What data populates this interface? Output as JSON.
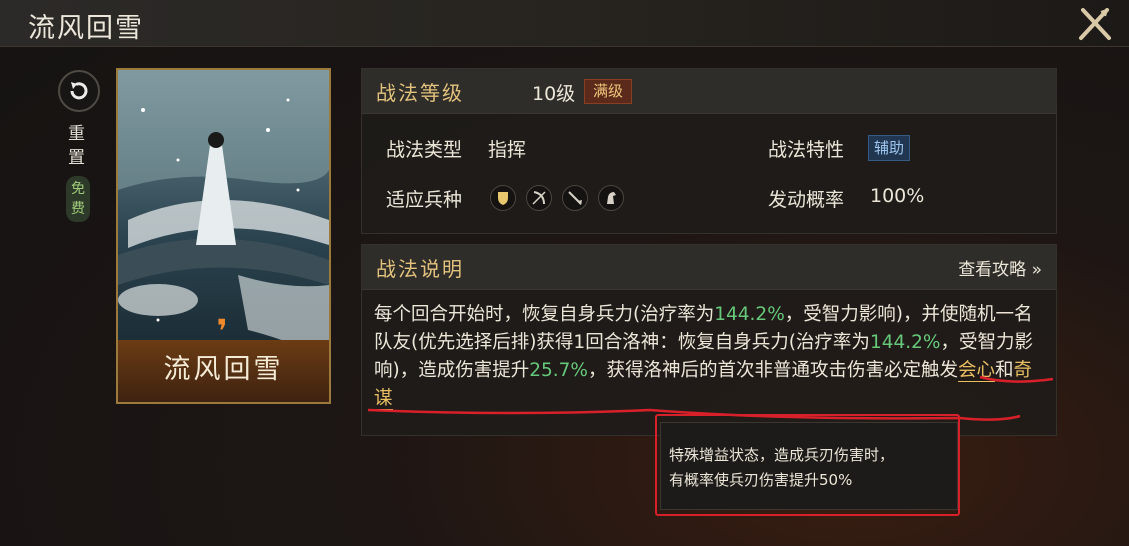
{
  "header": {
    "title": "流风回雪"
  },
  "reset": {
    "label": "重置",
    "free_label": "免费"
  },
  "card": {
    "name": "流风回雪",
    "type_icon": "comma-type-icon"
  },
  "level_panel": {
    "title": "战法等级",
    "level": "10级",
    "max_badge": "满级",
    "type_label": "战法类型",
    "type_value": "指挥",
    "trait_label": "战法特性",
    "trait_value": "辅助",
    "troop_label": "适应兵种",
    "troop_icons": [
      "shield-icon",
      "bow-icon",
      "spear-icon",
      "horse-icon"
    ],
    "chance_label": "发动概率",
    "chance_value": "100%"
  },
  "desc_panel": {
    "title": "战法说明",
    "guide_link": "查看攻略 »",
    "text_1": "每个回合开始时，恢复自身兵力(治疗率为",
    "rate_1": "144.2%",
    "text_2": "，受智力影响)，并使随机一名队友(优先选择后排)获得1回合洛神：恢复自身兵力(治疗率为",
    "rate_2": "144.2%",
    "text_3": "，受智力影响)，造成伤害提升",
    "rate_3": "25.7%",
    "text_4": "，获得洛神后的首次非普通攻击伤害必定触发",
    "keyword_1": "会心",
    "text_5": "和",
    "keyword_2": "奇谋"
  },
  "tooltip": {
    "text": "特殊增益状态，造成兵刃伤害时，\n有概率使兵刃伤害提升50%"
  },
  "colors": {
    "gold": "#e2c27c",
    "green": "#66c87a",
    "highlight_red": "#d8202a"
  }
}
